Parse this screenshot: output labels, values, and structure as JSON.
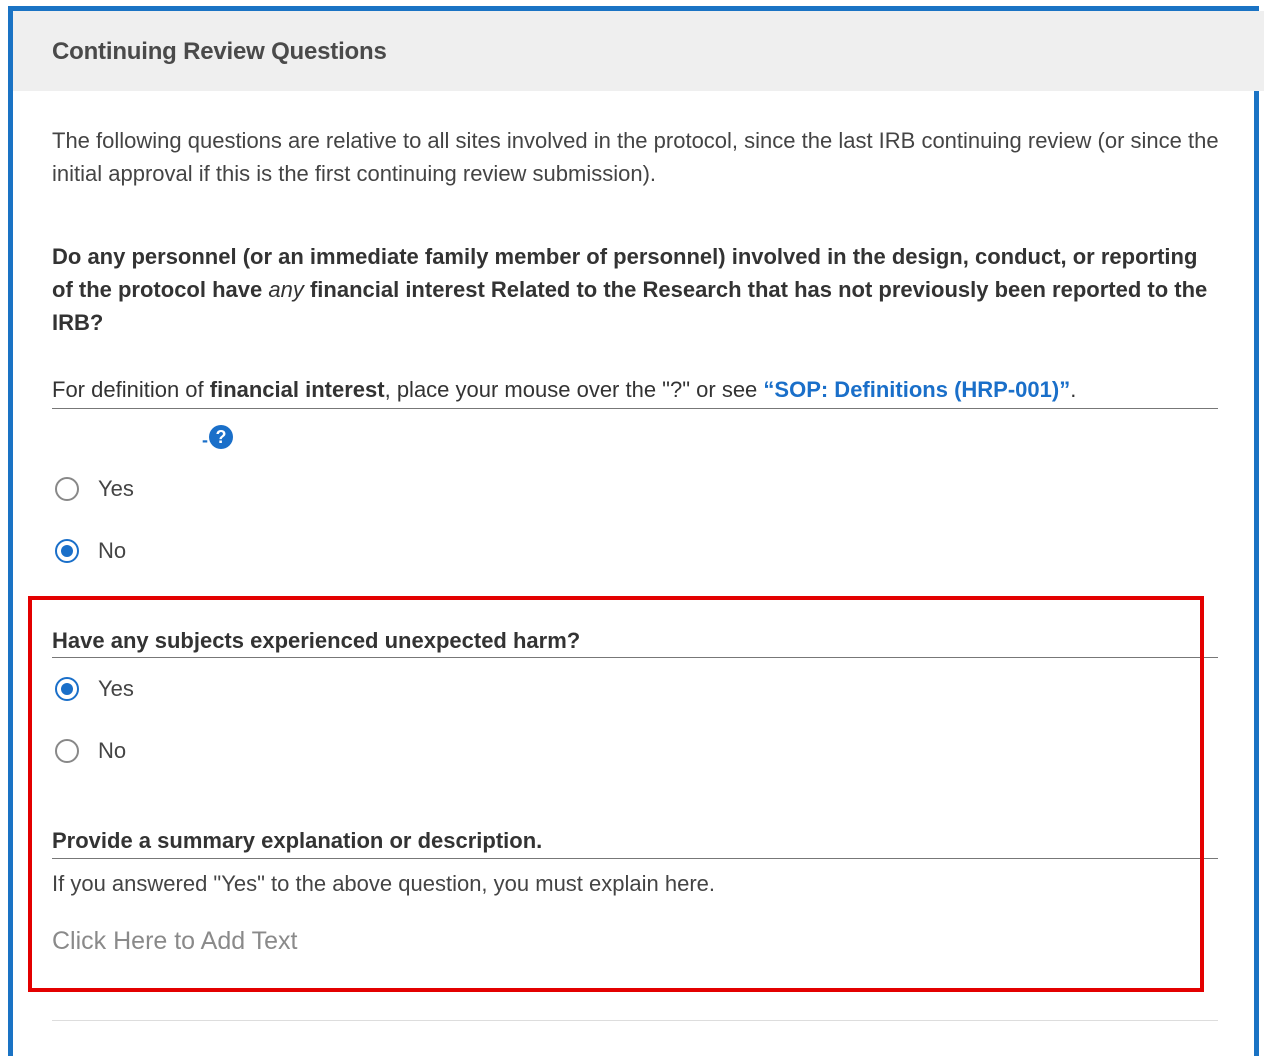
{
  "section": {
    "title": "Continuing Review Questions"
  },
  "intro": "The following questions are relative to all sites involved in the protocol, since the last IRB continuing review (or since the initial approval if this is the first continuing review submission).",
  "question1": {
    "text_lead": "Do any personnel (or an immediate family member of personnel) involved in the design, conduct, or reporting of the protocol have ",
    "text_emphasis": "any",
    "text_tail": " financial interest Related to the Research that has not previously been reported to the IRB?",
    "definition_prefix": "For definition of ",
    "definition_term": "financial interest",
    "definition_middle": ", place your mouse over the \"?\" or see ",
    "definition_link": "“SOP: Definitions (HRP-001)”",
    "definition_suffix": ".",
    "help_icon": "?",
    "options": [
      {
        "label": "Yes",
        "selected": false
      },
      {
        "label": "No",
        "selected": true
      }
    ]
  },
  "question2": {
    "text": "Have any subjects experienced unexpected harm?",
    "options": [
      {
        "label": "Yes",
        "selected": true
      },
      {
        "label": "No",
        "selected": false
      }
    ]
  },
  "question3": {
    "text": "Provide a summary explanation or description.",
    "help_text": "If you answered \"Yes\" to the above question, you must explain here.",
    "placeholder": "Click Here to Add Text"
  },
  "colors": {
    "frame_border": "#1a73c4",
    "highlight_border": "#e30000",
    "accent": "#1a6fc9",
    "header_bg": "#efefef"
  }
}
